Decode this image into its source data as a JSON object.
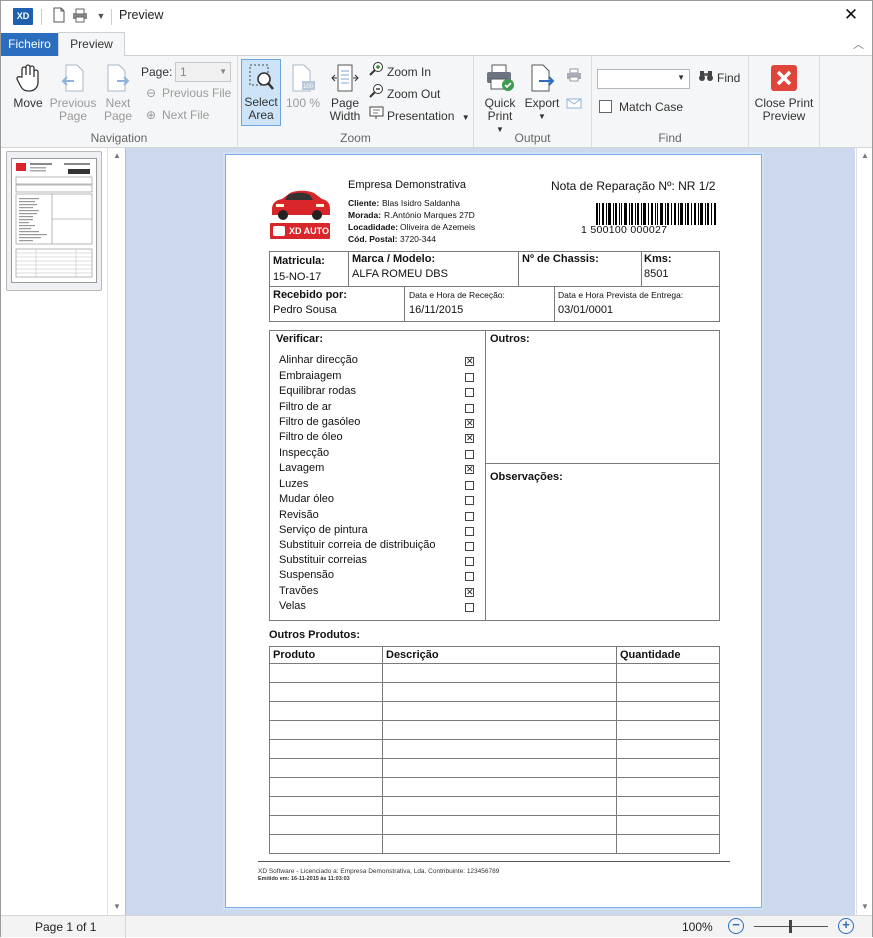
{
  "window": {
    "title": "Preview",
    "app_logo": "XD"
  },
  "tabs": {
    "file": "Ficheiro",
    "preview": "Preview"
  },
  "ribbon": {
    "navigation": {
      "label": "Navigation",
      "move": "Move",
      "previous_page": "Previous Page",
      "next_page": "Next Page",
      "page_label": "Page:",
      "page_value": "1",
      "previous_file": "Previous File",
      "next_file": "Next File"
    },
    "zoom": {
      "label": "Zoom",
      "select_area": "Select Area",
      "hundred": "100 %",
      "page_width": "Page Width",
      "zoom_in": "Zoom In",
      "zoom_out": "Zoom Out",
      "presentation": "Presentation"
    },
    "output": {
      "label": "Output",
      "quick_print": "Quick Print",
      "export": "Export"
    },
    "find": {
      "label": "Find",
      "find": "Find",
      "match_case": "Match Case"
    },
    "close": {
      "label": "Close Print Preview"
    }
  },
  "report": {
    "company": "Empresa Demonstrativa",
    "doc_title": "Nota de Reparação Nº: NR 1/2",
    "client_label": "Cliente:",
    "client": "Blas Isidro Saldanha",
    "address_label": "Morada:",
    "address": "R.António Marques 27D",
    "locality_label": "Locadidade:",
    "locality": "Oliveira de Azemeis",
    "postal_label": "Cód. Postal:",
    "postal": "3720-344",
    "logo_text": "XD AUTO",
    "barcode_text": "1   500100   000027",
    "matricula_label": "Matricula:",
    "matricula": "15-NO-17",
    "marca_label": "Marca / Modelo:",
    "marca": "ALFA ROMEU DBS",
    "chassis_label": "Nº de Chassis:",
    "kms_label": "Kms:",
    "kms": "8501",
    "recebido_label": "Recebido por:",
    "recebido": "Pedro Sousa",
    "rececao_label": "Data e Hora de Receção:",
    "rececao": "16/11/2015",
    "entrega_label": "Data e Hora Prevista de Entrega:",
    "entrega": "03/01/0001",
    "verificar_label": "Verificar:",
    "outros_label": "Outros:",
    "observacoes_label": "Observações:",
    "checklist": [
      {
        "label": "Alinhar direcção",
        "checked": true
      },
      {
        "label": "Embraiagem",
        "checked": false
      },
      {
        "label": "Equilibrar rodas",
        "checked": false
      },
      {
        "label": "Filtro de ar",
        "checked": false
      },
      {
        "label": "Filtro de gasóleo",
        "checked": true
      },
      {
        "label": "Filtro de óleo",
        "checked": true
      },
      {
        "label": "Inspecção",
        "checked": false
      },
      {
        "label": "Lavagem",
        "checked": true
      },
      {
        "label": "Luzes",
        "checked": false
      },
      {
        "label": "Mudar óleo",
        "checked": false
      },
      {
        "label": "Revisão",
        "checked": false
      },
      {
        "label": "Serviço de pintura",
        "checked": false
      },
      {
        "label": "Substituir correia de distribuição",
        "checked": false
      },
      {
        "label": "Substituir correias",
        "checked": false
      },
      {
        "label": "Suspensão",
        "checked": false
      },
      {
        "label": "Travões",
        "checked": true
      },
      {
        "label": "Velas",
        "checked": false
      }
    ],
    "outros_produtos_label": "Outros Produtos:",
    "columns": [
      "Produto",
      "Descrição",
      "Quantidade"
    ],
    "footer_line1": "XD Software - Licenciado a: Empresa Demonstrativa, Lda. Contribuinte: 123456789",
    "footer_line2": "Emitido em: 16-11-2015 às 11:03:03"
  },
  "status": {
    "page": "Page 1 of 1",
    "zoom": "100%"
  },
  "colors": {
    "accent": "#2b6ec0",
    "canvas": "#ccd8eb",
    "close_red": "#e0453b"
  }
}
